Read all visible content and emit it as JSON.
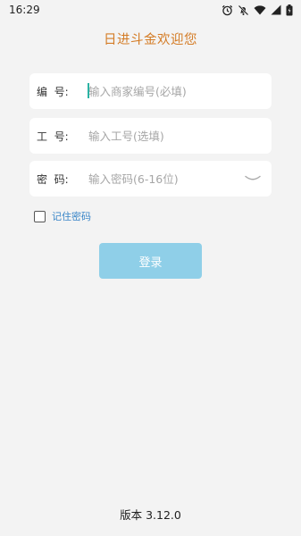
{
  "status_bar": {
    "time": "16:29",
    "icons": [
      "alarm-icon",
      "mute-icon",
      "wifi-icon",
      "signal-icon",
      "battery-icon"
    ]
  },
  "welcome_title": "日进斗金欢迎您",
  "form": {
    "merchant": {
      "label": "编  号:",
      "placeholder": "输入商家编号(必填)",
      "value": ""
    },
    "employee": {
      "label": "工  号:",
      "placeholder": "输入工号(选填)",
      "value": ""
    },
    "password": {
      "label": "密  码:",
      "placeholder": "输入密码(6-16位)",
      "value": "",
      "toggle_icon": "eye-closed-icon"
    },
    "remember": {
      "label": "记住密码",
      "checked": false
    },
    "login_label": "登录"
  },
  "version": "版本 3.12.0",
  "colors": {
    "background": "#f3f3f3",
    "welcome": "#d47c26",
    "button": "#8fcfe8",
    "link": "#3a86c8",
    "cursor": "#2bb3a4"
  }
}
